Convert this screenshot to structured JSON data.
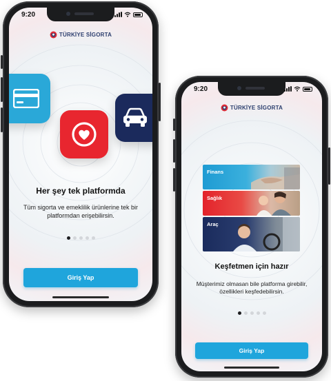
{
  "status": {
    "time": "9:20"
  },
  "brand": {
    "name": "TÜRKİYE SİGORTA"
  },
  "colors": {
    "accent": "#1fa5dc",
    "heart_tile": "#e8262f",
    "car_tile": "#1b2a5c",
    "card_tile": "#2aa8d8",
    "logo_text": "#2c3e6e",
    "logo_red": "#e12a36"
  },
  "icons": {
    "card": "credit-card-icon",
    "heart": "heart-icon",
    "car": "car-icon",
    "logo": "turkiye-sigorta-logo-icon"
  },
  "screens": [
    {
      "title": "Her şey tek platformda",
      "description": "Tüm sigorta ve emeklilik ürünlerine tek bir platformdan erişebilirsin.",
      "button_label": "Giriş Yap",
      "active_dot": 1,
      "dot_count": 5
    },
    {
      "title": "Keşfetmen için hazır",
      "description": "Müşterimiz olmasan bile platforma girebilir, özellikleri keşfedebilirsin.",
      "button_label": "Giriş Yap",
      "active_dot": 1,
      "dot_count": 5,
      "categories": [
        {
          "label": "Finans"
        },
        {
          "label": "Sağlık"
        },
        {
          "label": "Araç"
        }
      ]
    }
  ]
}
